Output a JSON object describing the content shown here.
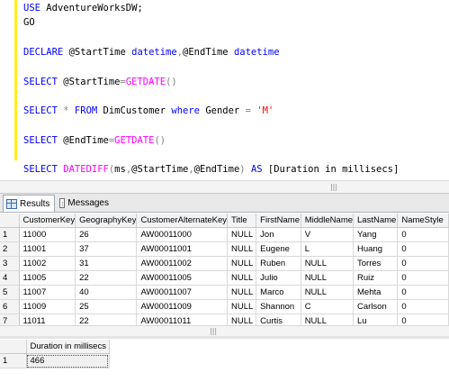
{
  "editor": {
    "lines": [
      [
        {
          "t": "USE ",
          "c": "kw"
        },
        {
          "t": "AdventureWorksDW;",
          "c": "plain"
        }
      ],
      [
        {
          "t": "GO",
          "c": "plain"
        }
      ],
      [],
      [
        {
          "t": "DECLARE ",
          "c": "kw"
        },
        {
          "t": "@StartTime ",
          "c": "plain"
        },
        {
          "t": "datetime",
          "c": "kw"
        },
        {
          "t": ",",
          "c": "op"
        },
        {
          "t": "@EndTime ",
          "c": "plain"
        },
        {
          "t": "datetime",
          "c": "kw"
        }
      ],
      [],
      [
        {
          "t": "SELECT ",
          "c": "kw"
        },
        {
          "t": "@StartTime",
          "c": "plain"
        },
        {
          "t": "=",
          "c": "op"
        },
        {
          "t": "GETDATE",
          "c": "fn"
        },
        {
          "t": "()",
          "c": "op"
        }
      ],
      [],
      [
        {
          "t": "SELECT ",
          "c": "kw"
        },
        {
          "t": "* ",
          "c": "op"
        },
        {
          "t": "FROM ",
          "c": "kw"
        },
        {
          "t": "DimCustomer ",
          "c": "plain"
        },
        {
          "t": "where ",
          "c": "kw"
        },
        {
          "t": "Gender ",
          "c": "plain"
        },
        {
          "t": "= ",
          "c": "op"
        },
        {
          "t": "'M'",
          "c": "str"
        }
      ],
      [],
      [
        {
          "t": "SELECT ",
          "c": "kw"
        },
        {
          "t": "@EndTime",
          "c": "plain"
        },
        {
          "t": "=",
          "c": "op"
        },
        {
          "t": "GETDATE",
          "c": "fn"
        },
        {
          "t": "()",
          "c": "op"
        }
      ],
      [],
      [
        {
          "t": "SELECT ",
          "c": "kw"
        },
        {
          "t": "DATEDIFF",
          "c": "fn"
        },
        {
          "t": "(",
          "c": "op"
        },
        {
          "t": "ms",
          "c": "plain"
        },
        {
          "t": ",",
          "c": "op"
        },
        {
          "t": "@StartTime",
          "c": "plain"
        },
        {
          "t": ",",
          "c": "op"
        },
        {
          "t": "@EndTime",
          "c": "plain"
        },
        {
          "t": ") ",
          "c": "op"
        },
        {
          "t": "AS ",
          "c": "kw"
        },
        {
          "t": "[Duration in millisecs]",
          "c": "plain"
        }
      ]
    ]
  },
  "tabs": {
    "results_label": "Results",
    "messages_label": "Messages"
  },
  "results_grid": {
    "columns": [
      "CustomerKey",
      "GeographyKey",
      "CustomerAlternateKey",
      "Title",
      "FirstName",
      "MiddleName",
      "LastName",
      "NameStyle"
    ],
    "rows": [
      {
        "n": "1",
        "cells": [
          "11000",
          "26",
          "AW00011000",
          "NULL",
          "Jon",
          "V",
          "Yang",
          "0"
        ]
      },
      {
        "n": "2",
        "cells": [
          "11001",
          "37",
          "AW00011001",
          "NULL",
          "Eugene",
          "L",
          "Huang",
          "0"
        ]
      },
      {
        "n": "3",
        "cells": [
          "11002",
          "31",
          "AW00011002",
          "NULL",
          "Ruben",
          "NULL",
          "Torres",
          "0"
        ]
      },
      {
        "n": "4",
        "cells": [
          "11005",
          "22",
          "AW00011005",
          "NULL",
          "Julio",
          "NULL",
          "Ruiz",
          "0"
        ]
      },
      {
        "n": "5",
        "cells": [
          "11007",
          "40",
          "AW00011007",
          "NULL",
          "Marco",
          "NULL",
          "Mehta",
          "0"
        ]
      },
      {
        "n": "6",
        "cells": [
          "11009",
          "25",
          "AW00011009",
          "NULL",
          "Shannon",
          "C",
          "Carlson",
          "0"
        ]
      },
      {
        "n": "7",
        "cells": [
          "11011",
          "22",
          "AW00011011",
          "NULL",
          "Curtis",
          "NULL",
          "Lu",
          "0"
        ]
      }
    ]
  },
  "duration_grid": {
    "column": "Duration in millisecs",
    "row_number": "1",
    "value": "466"
  }
}
